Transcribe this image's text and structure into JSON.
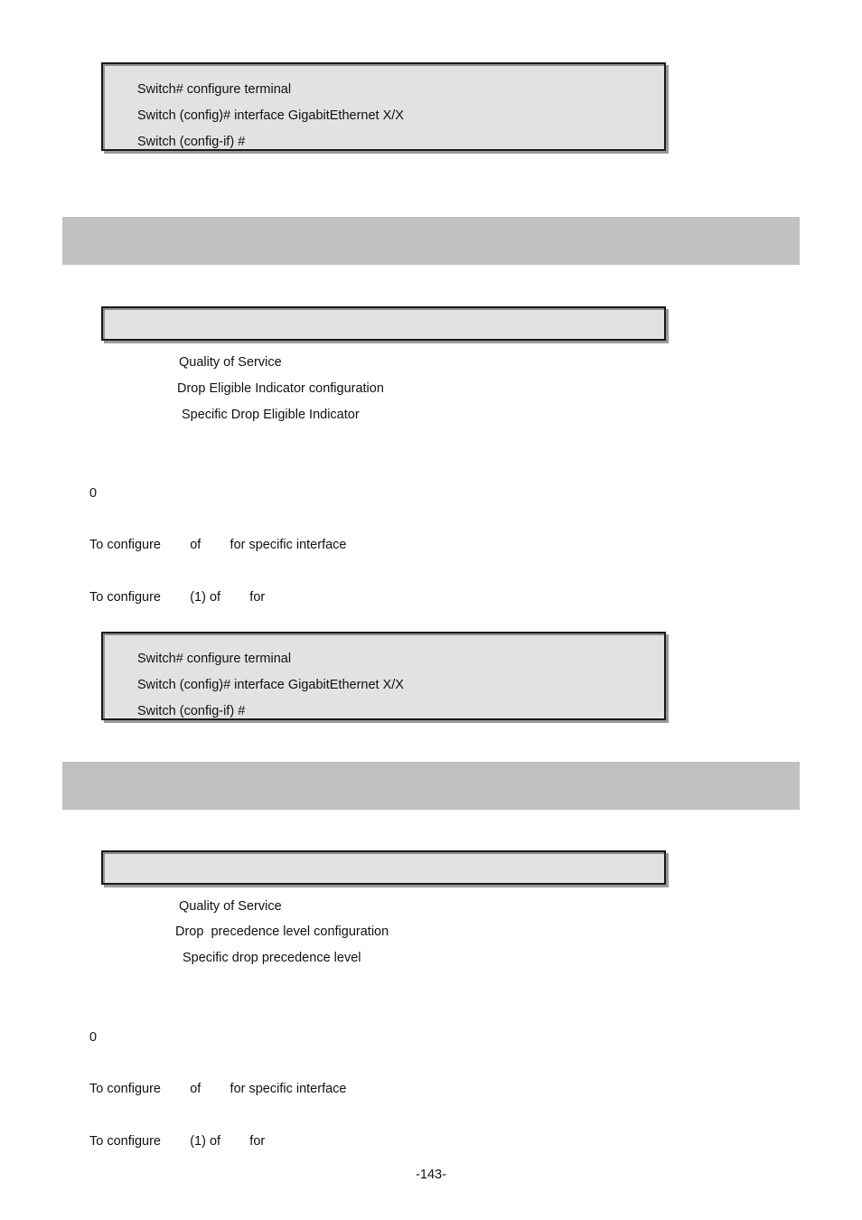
{
  "page": {
    "number_label": "-143-"
  },
  "section_one": {
    "header_bar_label": "",
    "command_box_label": "",
    "cli_block": {
      "lines": [
        "Switch# configure terminal",
        "Switch (config)# interface GigabitEthernet X/X",
        "Switch (config-if) #"
      ]
    },
    "description": {
      "line_1": "Quality of Service",
      "line_2": "Drop Eligible Indicator configuration",
      "line_3": "Specific Drop Eligible Indicator"
    },
    "default_value": "0",
    "usage_1": "To configure        of        for specific interface",
    "usage_2": "To configure        (1) of        for"
  },
  "section_two": {
    "header_bar_label": "",
    "command_box_label": "",
    "cli_block": {
      "lines": [
        "Switch# configure terminal",
        "Switch (config)# interface GigabitEthernet X/X",
        "Switch (config-if) #"
      ]
    },
    "description": {
      "line_1": "Quality of Service",
      "line_2": "Drop  precedence level configuration",
      "line_3": "Specific drop precedence level"
    },
    "default_value": "0",
    "usage_1": "To configure        of        for specific interface",
    "usage_2": "To configure        (1) of        for"
  }
}
